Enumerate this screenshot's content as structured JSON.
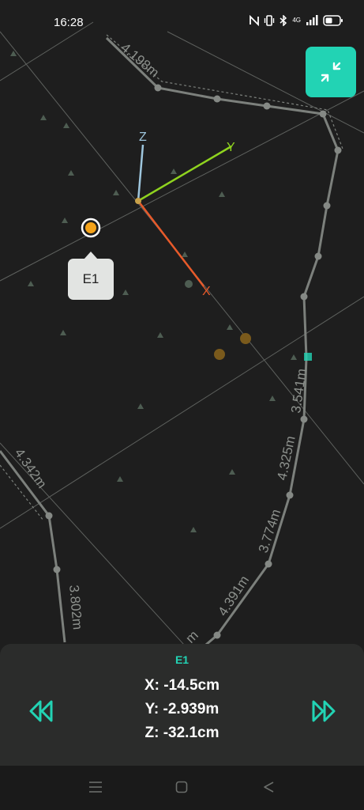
{
  "status_bar": {
    "time": "16:28",
    "network_label": "4G"
  },
  "map": {
    "current_point_label": "E1",
    "axes": {
      "x_label": "X",
      "y_label": "Y",
      "z_label": "Z"
    },
    "distance_labels": [
      "4.198m",
      "3.541m",
      "4.325m",
      "3.774m",
      "4.391m",
      "4.342m",
      "3.802m",
      "m"
    ],
    "colors": {
      "x_axis": "#e85a2a",
      "y_axis": "#8fd31f",
      "z_axis": "#9ec6dd",
      "point": "#f5a31a",
      "accent": "#22d3b4"
    }
  },
  "panel": {
    "point_name": "E1",
    "x": "X: -14.5cm",
    "y": "Y: -2.939m",
    "z": "Z: -32.1cm"
  },
  "icons": {
    "collapse": "collapse-icon",
    "prev": "double-chevron-left-icon",
    "next": "double-chevron-right-icon"
  }
}
